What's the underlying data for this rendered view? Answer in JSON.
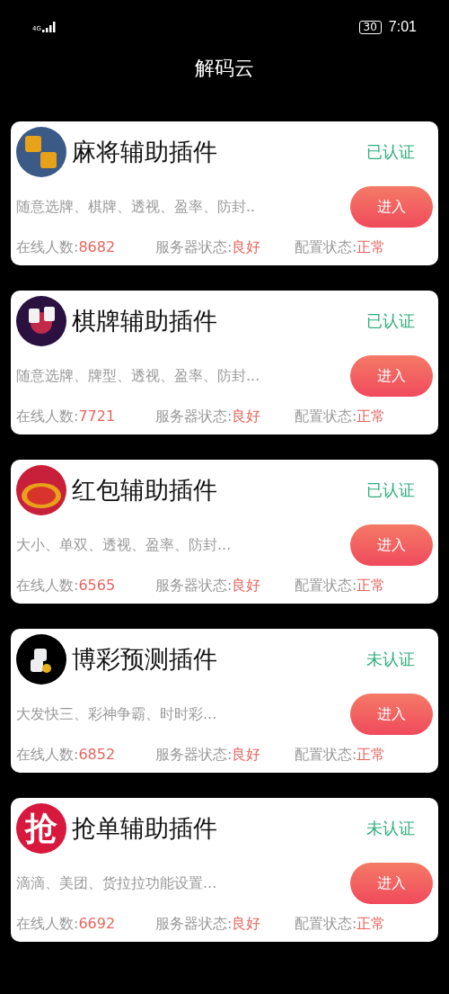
{
  "status_bar": {
    "network": "4G",
    "battery": "30",
    "time": "7:01"
  },
  "header": {
    "title": "解码云"
  },
  "plugins": [
    {
      "logo": {
        "kind": "mahjong"
      },
      "title": "麻将辅助插件",
      "certification": "已认证",
      "description": "随意选牌、棋牌、透视、盈率、防封..",
      "button": "进入",
      "stats": [
        {
          "label": "在线人数:",
          "value": "8682"
        },
        {
          "label": "服务器状态:",
          "value": "良好"
        },
        {
          "label": "配置状态:",
          "value": "正常"
        }
      ]
    },
    {
      "logo": {
        "kind": "casino"
      },
      "title": "棋牌辅助插件",
      "certification": "已认证",
      "description": "随意选牌、牌型、透视、盈率、防封...",
      "button": "进入",
      "stats": [
        {
          "label": "在线人数:",
          "value": "7721"
        },
        {
          "label": "服务器状态:",
          "value": "良好"
        },
        {
          "label": "配置状态:",
          "value": "正常"
        }
      ]
    },
    {
      "logo": {
        "kind": "emblem"
      },
      "title": "红包辅助插件",
      "certification": "已认证",
      "description": "大小、单双、透视、盈率、防封...",
      "button": "进入",
      "stats": [
        {
          "label": "在线人数:",
          "value": "6565"
        },
        {
          "label": "服务器状态:",
          "value": "良好"
        },
        {
          "label": "配置状态:",
          "value": "正常"
        }
      ]
    },
    {
      "logo": {
        "kind": "dice"
      },
      "title": "博彩预测插件",
      "certification": "未认证",
      "description": "大发快三、彩神争霸、时时彩...",
      "button": "进入",
      "stats": [
        {
          "label": "在线人数:",
          "value": "6852"
        },
        {
          "label": "服务器状态:",
          "value": "良好"
        },
        {
          "label": "配置状态:",
          "value": "正常"
        }
      ]
    },
    {
      "logo": {
        "kind": "text",
        "text": "抢"
      },
      "title": "抢单辅助插件",
      "certification": "未认证",
      "description": "滴滴、美团、货拉拉功能设置...",
      "button": "进入",
      "stats": [
        {
          "label": "在线人数:",
          "value": "6692"
        },
        {
          "label": "服务器状态:",
          "value": "良好"
        },
        {
          "label": "配置状态:",
          "value": "正常"
        }
      ]
    }
  ]
}
